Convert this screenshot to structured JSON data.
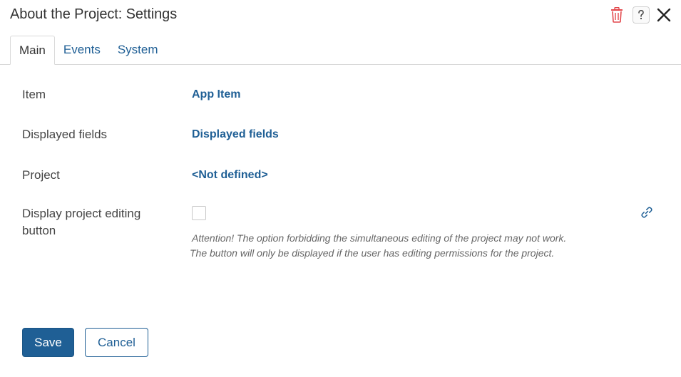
{
  "dialog": {
    "title": "About the Project: Settings"
  },
  "header_icons": {
    "delete": "trash-icon",
    "help": "help-icon",
    "close": "close-icon",
    "delete_color": "#e2474b"
  },
  "tabs": [
    {
      "label": "Main",
      "active": true
    },
    {
      "label": "Events",
      "active": false
    },
    {
      "label": "System",
      "active": false
    }
  ],
  "form": {
    "item": {
      "label": "Item",
      "value": "App Item"
    },
    "displayed_fields": {
      "label": "Displayed fields",
      "value": "Displayed fields"
    },
    "project": {
      "label": "Project",
      "value": "<Not defined>"
    },
    "editing_button": {
      "label": "Display project editing button",
      "checked": false,
      "note_line1": "Attention! The option forbidding the simultaneous editing of the project may not work.",
      "note_line2": "The button will only be displayed if the user has editing  permissions for the project."
    }
  },
  "buttons": {
    "save": "Save",
    "cancel": "Cancel"
  },
  "colors": {
    "accent": "#1f5f95",
    "danger": "#e2474b"
  }
}
